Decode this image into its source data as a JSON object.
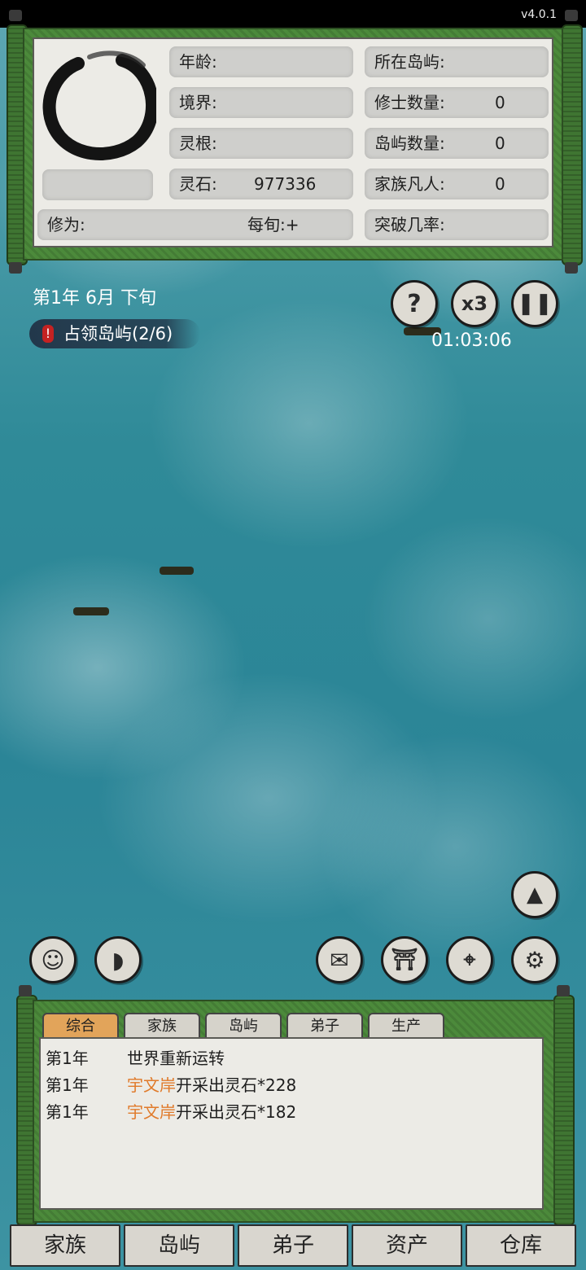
{
  "app": {
    "version": "v4.0.1"
  },
  "stats": {
    "age_label": "年龄:",
    "realm_label": "境界:",
    "root_label": "灵根:",
    "stone_label": "灵石:",
    "stone_value": "977336",
    "cultivation_label": "修为:",
    "per_turn_label": "每旬:+",
    "island_label": "所在岛屿:",
    "cultivators_label": "修士数量:",
    "cultivators_value": "0",
    "island_count_label": "岛屿数量:",
    "island_count_value": "0",
    "mortals_label": "家族凡人:",
    "mortals_value": "0",
    "breakthrough_label": "突破几率:"
  },
  "hud": {
    "date": "第1年 6月 下旬",
    "quest": "占领岛屿(2/6)",
    "timer": "01:03:06",
    "speed_label": "x3"
  },
  "log": {
    "tabs": [
      "综合",
      "家族",
      "岛屿",
      "弟子",
      "生产"
    ],
    "entries": [
      {
        "year": "第1年",
        "name": "",
        "text": "世界重新运转"
      },
      {
        "year": "第1年",
        "name": "宇文岸",
        "text": "开采出灵石*228"
      },
      {
        "year": "第1年",
        "name": "宇文岸",
        "text": "开采出灵石*182"
      }
    ]
  },
  "bottom_nav": [
    "家族",
    "岛屿",
    "弟子",
    "资产",
    "仓库"
  ],
  "icons": {
    "help": "question-icon",
    "speed": "speed-x3-icon",
    "pause": "pause-icon",
    "mountain": "mountain-icon",
    "character": "character-icon",
    "horn": "horn-icon",
    "mail": "mail-icon",
    "shrine": "shrine-icon",
    "location": "location-pin-icon",
    "settings": "gear-icon"
  },
  "colors": {
    "active_tab": "#e2a45a",
    "name_highlight": "#e07a2a",
    "frame_green": "#4c8a3b"
  }
}
